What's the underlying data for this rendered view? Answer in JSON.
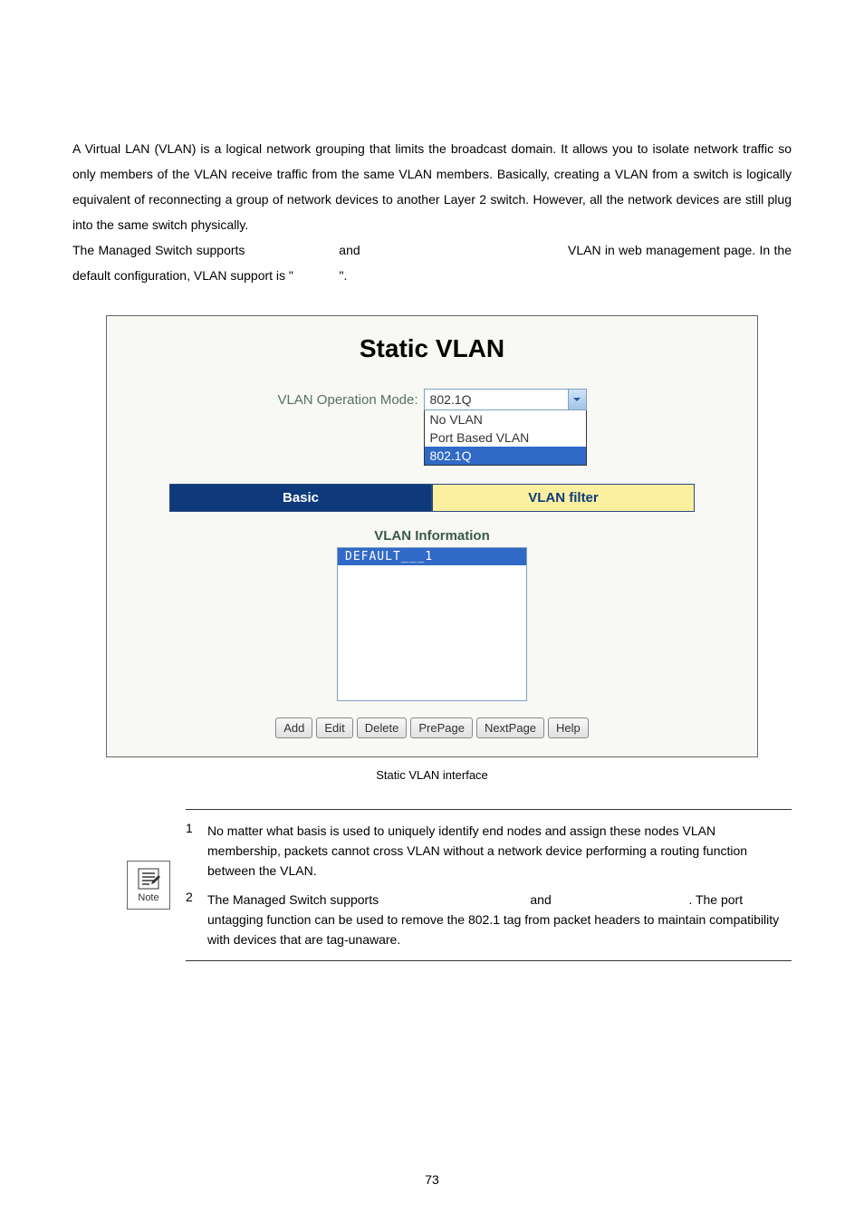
{
  "body": {
    "p1_a": "A Virtual LAN (VLAN) is a logical network grouping that limits the broadcast domain. It allows you to isolate network traffic so only members of the VLAN receive traffic from the same VLAN members. Basically, creating a VLAN from a switch is logically equivalent of reconnecting a group of network devices to another Layer 2 switch. However, all the network devices are still plug into the same switch physically.",
    "p2_a": "The Managed Switch supports ",
    "p2_b": "and ",
    "p2_c": "VLAN in web management page. In the default configuration, VLAN support is \"",
    "p2_d": "\"."
  },
  "panel": {
    "title": "Static VLAN",
    "modeLabel": "VLAN Operation Mode:",
    "modeSelected": "802.1Q",
    "options": [
      "No VLAN",
      "Port Based VLAN",
      "802.1Q"
    ],
    "tabs": {
      "basic": "Basic",
      "filter": "VLAN filter"
    },
    "infoTitle": "VLAN Information",
    "infoItem": "DEFAULT___1",
    "buttons": {
      "add": "Add",
      "edit": "Edit",
      "delete": "Delete",
      "prev": "PrePage",
      "next": "NextPage",
      "help": "Help"
    }
  },
  "caption": "Static VLAN interface",
  "note": {
    "iconLabel": "Note",
    "items": [
      {
        "num": "1",
        "text_a": "No matter what basis is used to uniquely identify end nodes and assign these nodes VLAN membership, packets cannot cross VLAN without a network device performing a routing function between the VLAN."
      },
      {
        "num": "2",
        "text_a": "The Managed Switch supports ",
        "text_b": "and ",
        "text_c": ". The port untagging function can be used to remove the 802.1 tag from packet headers to maintain compatibility with devices that are tag-unaware."
      }
    ]
  },
  "pageNumber": "73"
}
